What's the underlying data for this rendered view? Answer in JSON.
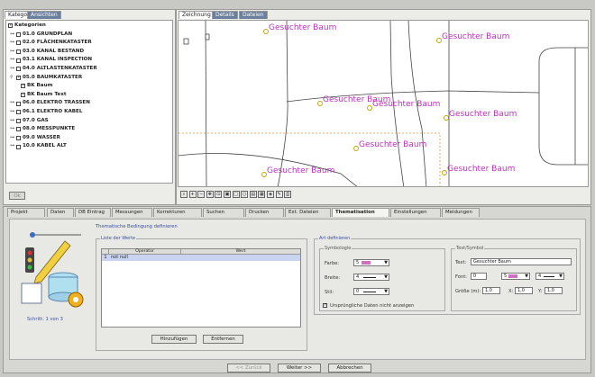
{
  "left_tabs": [
    "Kategorien",
    "Ansichten"
  ],
  "tree": {
    "root": "Kategorien",
    "items": [
      {
        "label": "01.0 GRUNDPLAN",
        "level": 0,
        "checked": false
      },
      {
        "label": "02.0 FLÄCHENKATASTER",
        "level": 0,
        "checked": false
      },
      {
        "label": "03.0 KANAL BESTAND",
        "level": 0,
        "checked": false
      },
      {
        "label": "03.1 KANAL INSPECTION",
        "level": 0,
        "checked": false
      },
      {
        "label": "04.0 ALTLASTENKATASTER",
        "level": 0,
        "checked": false
      },
      {
        "label": "05.0 BAUMKATASTER",
        "level": 0,
        "checked": true
      },
      {
        "label": "BK Baum",
        "level": 1,
        "checked": true
      },
      {
        "label": "BK Baum Text",
        "level": 1,
        "checked": true
      },
      {
        "label": "06.0 ELEKTRO TRASSEN",
        "level": 0,
        "checked": false
      },
      {
        "label": "06.1 ELEKTRO KABEL",
        "level": 0,
        "checked": false
      },
      {
        "label": "07.0 GAS",
        "level": 0,
        "checked": false
      },
      {
        "label": "08.0 MESSPUNKTE",
        "level": 0,
        "checked": false
      },
      {
        "label": "09.0 WASSER",
        "level": 0,
        "checked": false
      },
      {
        "label": "10.0 KABEL ALT",
        "level": 0,
        "checked": false
      }
    ]
  },
  "tree_footer_button": "Ok",
  "map_tabs": [
    "Zeichnung",
    "Details",
    "Dateien"
  ],
  "map_label": "Gesuchter Baum",
  "map_labels": [
    {
      "text": "Gesuchter Baum"
    },
    {
      "text": "Gesuchter Baum"
    },
    {
      "text": "Gesuchter Baum"
    },
    {
      "text": "Gesuchter Baum"
    },
    {
      "text": "Gesuchter Baum"
    },
    {
      "text": "Gesuchter Baum"
    },
    {
      "text": "Gesuchter Baum"
    },
    {
      "text": "Gesuchter Baum"
    }
  ],
  "map_tools": [
    "zoom-icon",
    "zoom-in-icon",
    "zoom-out-icon",
    "pan-icon",
    "fit-icon",
    "window-icon",
    "rect-icon",
    "circle-icon",
    "table-icon",
    "grid-icon",
    "layer-icon",
    "tool-icon",
    "print-icon"
  ],
  "bottom_tabs": [
    "Projekt",
    "Daten",
    "DB Eintrag",
    "Messungen",
    "Korrekturen",
    "Suchen",
    "Drucken",
    "Ext. Dateien",
    "Thematisation",
    "Einstellungen",
    "Meldungen"
  ],
  "active_bottom_tab": "Thematisation",
  "wizard": {
    "heading": "Thematische Bedingung definieren",
    "step": "Schritt: 1 von 3",
    "liste_title": "Liste der Werte",
    "col_operator": "Operator",
    "col_wert": "Wert",
    "row_num": "1",
    "row_value": "not null",
    "btn_add": "Hinzufügen",
    "btn_remove": "Entfernen",
    "art_title": "Art definieren",
    "symbologie_title": "Symbologie",
    "farbe_label": "Farbe:",
    "farbe_value": "5",
    "farbe_color": "#d070c0",
    "breite_label": "Breite:",
    "breite_value": "4",
    "stil_label": "Stil:",
    "stil_value": "0",
    "checkbox_label": "Ursprüngliche Daten nicht anzeigen",
    "text_title": "Text/Symbol",
    "text_label": "Text:",
    "text_value": "Gesuchter Baum",
    "font_label": "Font:",
    "font_value": "0",
    "font_color_value": "5",
    "font_size_value": "4",
    "groesse_label": "Größe (m):",
    "groesse_value": "1,0",
    "x_label": "X:",
    "x_value": "1,0",
    "y_label": "Y:",
    "y_value": "1,0",
    "btn_back": "<< Zurück",
    "btn_next": "Weiter >>",
    "btn_cancel": "Abbrechen"
  },
  "colors": {
    "label_color": "#c030c0",
    "symbol_color": "#c8a000",
    "dashed_color": "#e89040",
    "tab_inactive": "#6b7f9e"
  }
}
